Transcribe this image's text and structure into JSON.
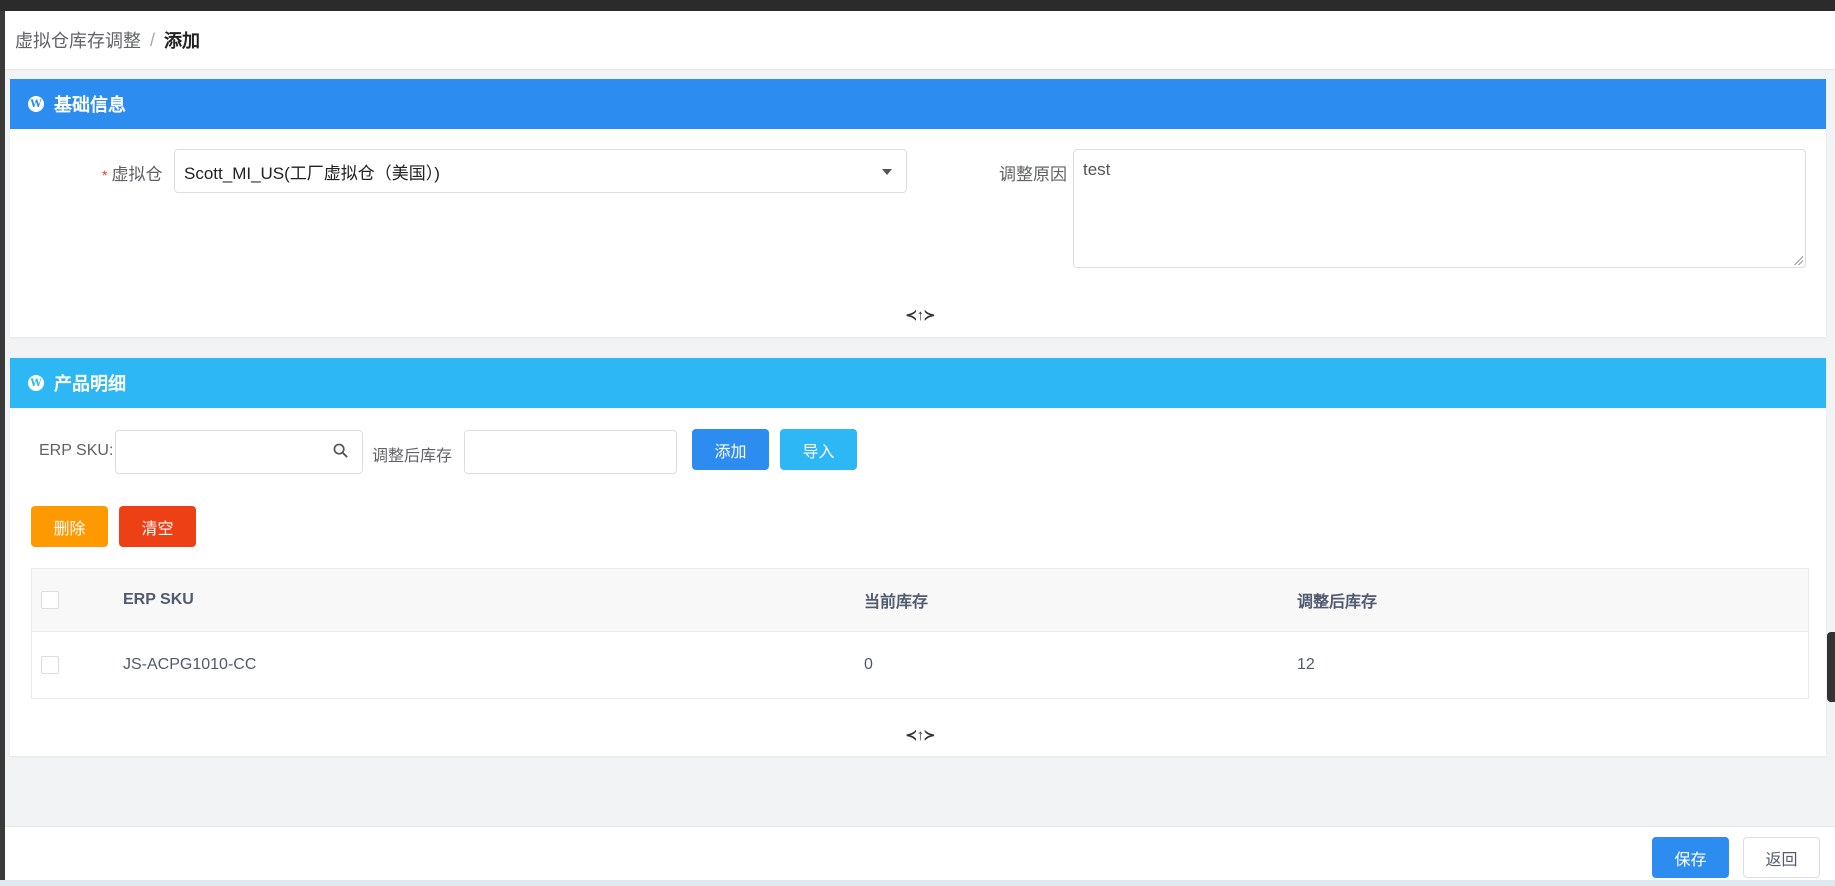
{
  "breadcrumb": {
    "parent": "虚拟仓库存调整",
    "separator": "/",
    "current": "添加"
  },
  "basic_info": {
    "title": "基础信息",
    "warehouse_label": "虚拟仓",
    "warehouse_required_mark": "*",
    "warehouse_value": "Scott_MI_US(工厂虚拟仓（美国）)",
    "reason_label": "调整原因",
    "reason_value": "test",
    "collapse_glyph": "≺↑≻"
  },
  "product_detail": {
    "title": "产品明细",
    "sku_label": "ERP SKU:",
    "sku_value": "",
    "adjusted_stock_label": "调整后库存",
    "adjusted_stock_value": "",
    "add_button": "添加",
    "import_button": "导入",
    "delete_button": "删除",
    "clear_button": "清空",
    "collapse_glyph": "≺↑≻",
    "table": {
      "columns": [
        "ERP SKU",
        "当前库存",
        "调整后库存"
      ],
      "rows": [
        {
          "sku": "JS-ACPG1010-CC",
          "current": "0",
          "adjusted": "12"
        }
      ]
    }
  },
  "footer": {
    "save_button": "保存",
    "back_button": "返回"
  },
  "colors": {
    "primary": "#2d8cf0",
    "info": "#2db7f5",
    "warning": "#ff9900",
    "error": "#ed4014"
  }
}
